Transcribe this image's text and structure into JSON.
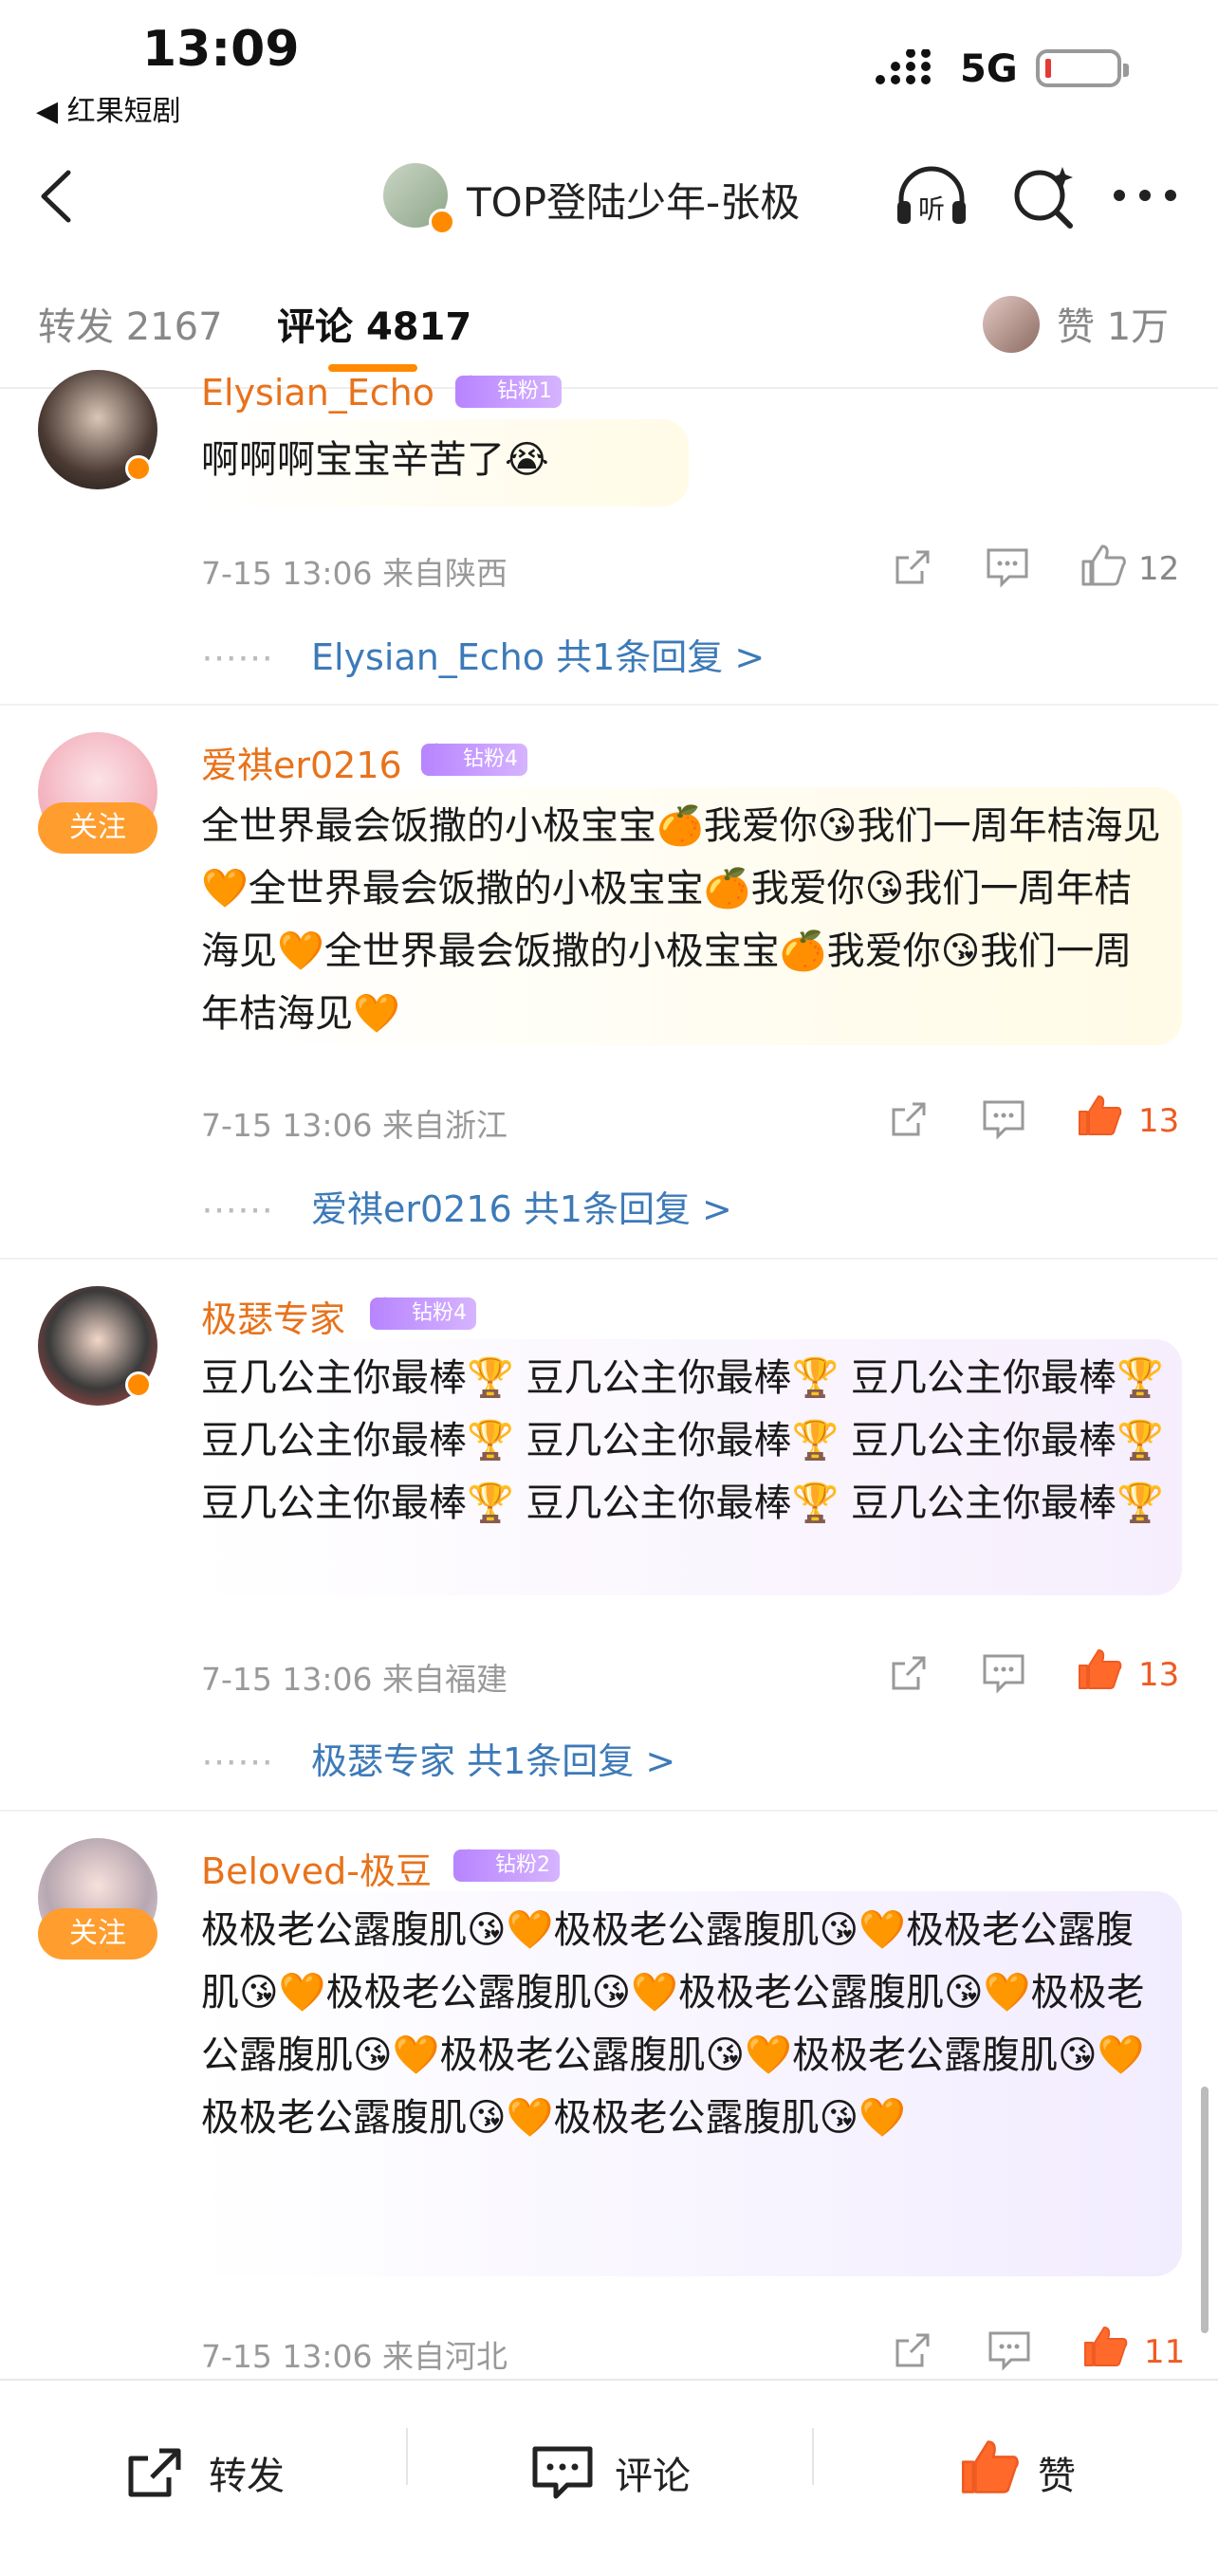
{
  "status": {
    "time": "13:09",
    "back_app": "◀ 红果短剧",
    "network": "5G"
  },
  "nav": {
    "title": "TOP登陆少年-张极",
    "icons": [
      "back-icon",
      "headphone-listen-icon",
      "search-sparkle-icon",
      "more-icon"
    ],
    "listen_label": "听"
  },
  "tabs": {
    "repost_label": "转发",
    "repost_count": "2167",
    "comment_label": "评论",
    "comment_count": "4817",
    "like_label": "赞",
    "like_count": "1万"
  },
  "comments": [
    {
      "user": "Elysian_Echo",
      "badge": "钻粉1",
      "text": "啊啊啊宝宝辛苦了😭",
      "time": "7-15 13:06",
      "location": "来自陕西",
      "likes": "12",
      "liked": false,
      "replies": "Elysian_Echo  共1条回复 >"
    },
    {
      "user": "爱祺er0216",
      "badge": "钻粉4",
      "follow": "关注",
      "text": "全世界最会饭撒的小极宝宝🍊我爱你😘我们一周年桔海见🧡全世界最会饭撒的小极宝宝🍊我爱你😘我们一周年桔海见🧡全世界最会饭撒的小极宝宝🍊我爱你😘我们一周年桔海见🧡",
      "time": "7-15 13:06",
      "location": "来自浙江",
      "likes": "13",
      "liked": true,
      "replies": "爱祺er0216  共1条回复 >"
    },
    {
      "user": "极瑟专家",
      "badge": "钻粉4",
      "text": "豆几公主你最棒🏆 豆几公主你最棒🏆 豆几公主你最棒🏆 豆几公主你最棒🏆 豆几公主你最棒🏆 豆几公主你最棒🏆 豆几公主你最棒🏆 豆几公主你最棒🏆 豆几公主你最棒🏆",
      "time": "7-15 13:06",
      "location": "来自福建",
      "likes": "13",
      "liked": true,
      "replies": "极瑟专家  共1条回复 >"
    },
    {
      "user": "Beloved-极豆",
      "badge": "钻粉2",
      "follow": "关注",
      "text": "极极老公露腹肌😘🧡极极老公露腹肌😘🧡极极老公露腹肌😘🧡极极老公露腹肌😘🧡极极老公露腹肌😘🧡极极老公露腹肌😘🧡极极老公露腹肌😘🧡极极老公露腹肌😘🧡极极老公露腹肌😘🧡极极老公露腹肌😘🧡",
      "time": "7-15 13:06",
      "location": "来自河北",
      "likes": "11",
      "liked": true
    }
  ],
  "bottom": {
    "repost": "转发",
    "comment": "评论",
    "like": "赞"
  },
  "colors": {
    "accent": "#ff8a00",
    "username": "#e8721a",
    "link": "#3d7ab8",
    "like_hot": "#ee5b23",
    "fan_badge": "#b784ff"
  }
}
